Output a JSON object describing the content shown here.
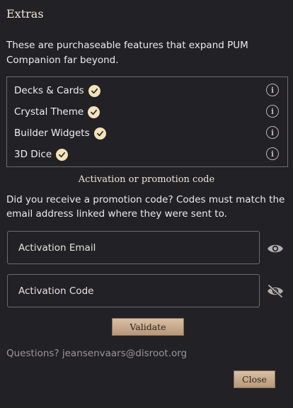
{
  "header": {
    "title": "Extras"
  },
  "description": "These are purchaseable features that expand PUM Companion far beyond.",
  "features": [
    {
      "label": "Decks & Cards",
      "icon": "check-circle-icon",
      "info_icon": "info-icon"
    },
    {
      "label": "Crystal Theme",
      "icon": "check-circle-icon",
      "info_icon": "info-icon"
    },
    {
      "label": "Builder Widgets",
      "icon": "check-circle-icon",
      "info_icon": "info-icon"
    },
    {
      "label": "3D Dice",
      "icon": "check-circle-icon",
      "info_icon": "info-icon"
    }
  ],
  "activation": {
    "section_title": "Activation or promotion code",
    "help_text": "Did you receive a promotion code? Codes must match the email address linked where they were sent to.",
    "email_placeholder": "Activation Email",
    "email_value": "",
    "code_placeholder": "Activation Code",
    "code_value": "",
    "email_visibility_icon": "eye-icon",
    "code_visibility_icon": "eye-off-icon",
    "validate_label": "Validate"
  },
  "footer": {
    "contact": "Questions? jeansenvaars@disroot.org",
    "close_label": "Close"
  },
  "colors": {
    "background": "#222126",
    "accent": "#f3e3b8",
    "button": "#c9ab8d"
  }
}
